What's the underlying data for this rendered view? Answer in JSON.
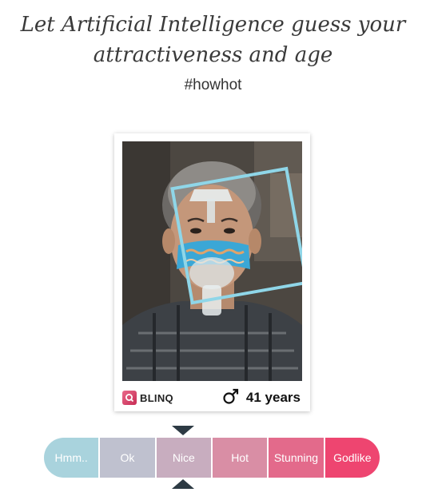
{
  "header": {
    "line1": "Let Artificial Intelligence guess your",
    "line2": "attractiveness and age",
    "hashtag": "#howhot"
  },
  "card": {
    "brand": "BLINQ",
    "brand_icon": "blinq-logo-icon",
    "gender_icon": "male-symbol-icon",
    "age_label": "41 years"
  },
  "scale": {
    "selected": "Nice",
    "items": [
      {
        "label": "Hmm..",
        "color": "#a9d3dd"
      },
      {
        "label": "Ok",
        "color": "#bfc1cf"
      },
      {
        "label": "Nice",
        "color": "#c8adbf"
      },
      {
        "label": "Hot",
        "color": "#d98ea5"
      },
      {
        "label": "Stunning",
        "color": "#e36a8b"
      },
      {
        "label": "Godlike",
        "color": "#ee4570"
      }
    ]
  },
  "colors": {
    "face_box": "#8fd6e8",
    "brand_accent": "#d63864",
    "pointer": "#2d3a44"
  }
}
